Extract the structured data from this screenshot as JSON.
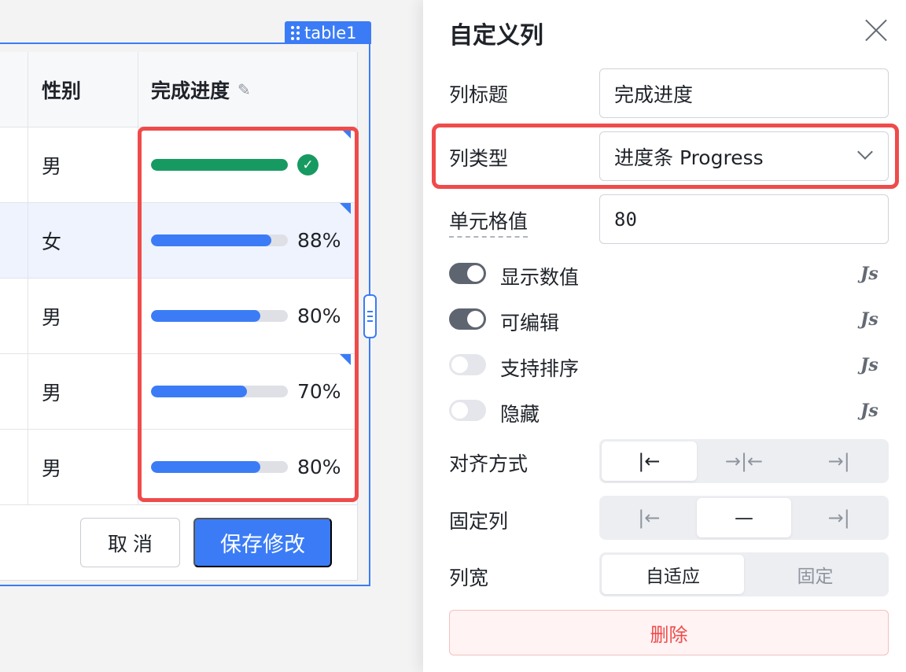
{
  "table": {
    "tag_label": "table1",
    "headers": {
      "gender": "性别",
      "progress": "完成进度"
    },
    "rows": [
      {
        "gender": "男",
        "progress": 100,
        "progress_text": "",
        "completed": true
      },
      {
        "gender": "女",
        "progress": 88,
        "progress_text": "88%",
        "completed": false
      },
      {
        "gender": "男",
        "progress": 80,
        "progress_text": "80%",
        "completed": false
      },
      {
        "gender": "男",
        "progress": 70,
        "progress_text": "70%",
        "completed": false
      },
      {
        "gender": "男",
        "progress": 80,
        "progress_text": "80%",
        "completed": false
      }
    ],
    "cancel_label": "取 消",
    "save_label": "保存修改"
  },
  "panel": {
    "title": "自定义列",
    "column_title_label": "列标题",
    "column_title_value": "完成进度",
    "column_type_label": "列类型",
    "column_type_value": "进度条 Progress",
    "cell_value_label": "单元格值",
    "cell_value": "80",
    "toggles": [
      {
        "label": "显示数值",
        "on": true,
        "js": "Js"
      },
      {
        "label": "可编辑",
        "on": true,
        "js": "Js"
      },
      {
        "label": "支持排序",
        "on": false,
        "js": "Js"
      },
      {
        "label": "隐藏",
        "on": false,
        "js": "Js"
      }
    ],
    "align_label": "对齐方式",
    "align_options": [
      "|←",
      "→|←",
      "→|"
    ],
    "align_selected": 0,
    "fixed_label": "固定列",
    "fixed_options": [
      "|←",
      "—",
      "→|"
    ],
    "fixed_selected": 1,
    "width_label": "列宽",
    "width_options": [
      "自适应",
      "固定"
    ],
    "width_selected": 0,
    "delete_label": "删除"
  },
  "colors": {
    "accent": "#3b7cf6",
    "success": "#179a62",
    "danger": "#ef4b4b"
  }
}
